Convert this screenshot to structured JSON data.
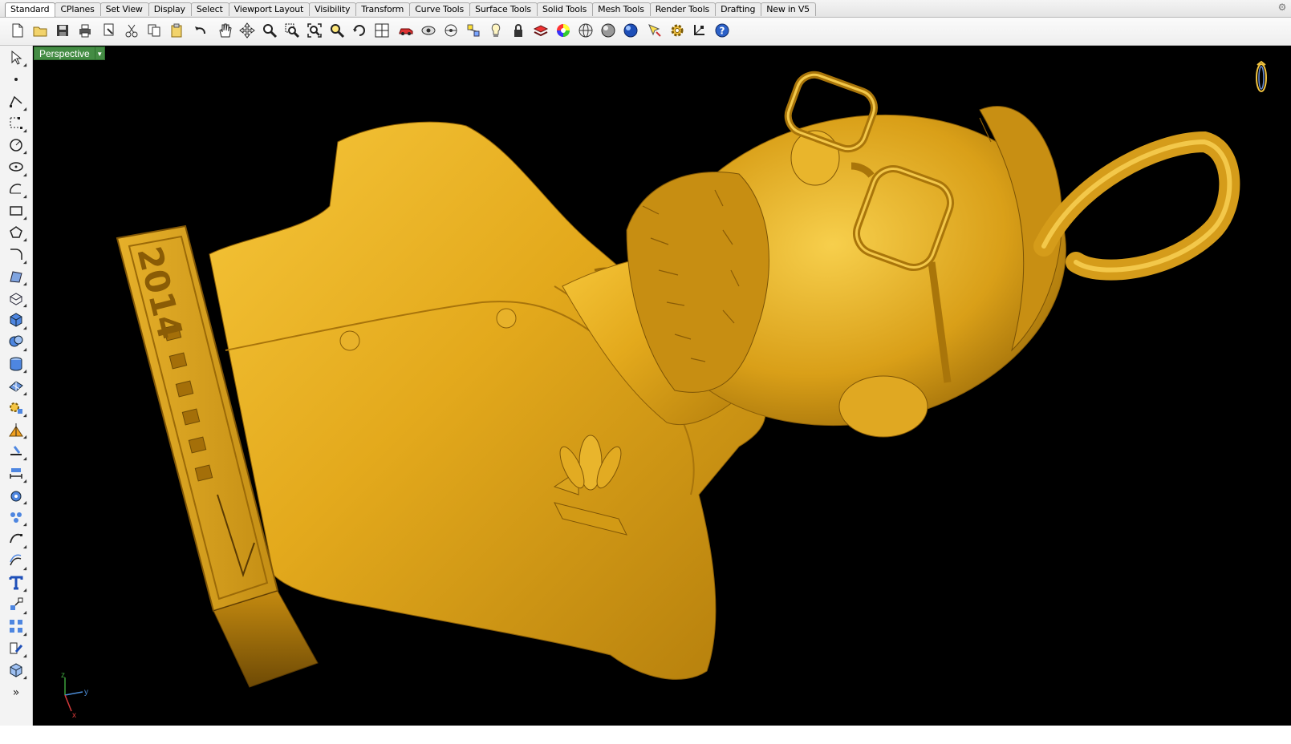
{
  "tabs": [
    {
      "label": "Standard",
      "active": true
    },
    {
      "label": "CPlanes",
      "active": false
    },
    {
      "label": "Set View",
      "active": false
    },
    {
      "label": "Display",
      "active": false
    },
    {
      "label": "Select",
      "active": false
    },
    {
      "label": "Viewport Layout",
      "active": false
    },
    {
      "label": "Visibility",
      "active": false
    },
    {
      "label": "Transform",
      "active": false
    },
    {
      "label": "Curve Tools",
      "active": false
    },
    {
      "label": "Surface Tools",
      "active": false
    },
    {
      "label": "Solid Tools",
      "active": false
    },
    {
      "label": "Mesh Tools",
      "active": false
    },
    {
      "label": "Render Tools",
      "active": false
    },
    {
      "label": "Drafting",
      "active": false
    },
    {
      "label": "New in V5",
      "active": false
    }
  ],
  "toolbar_icons": [
    "new-icon",
    "open-icon",
    "save-icon",
    "print-icon",
    "import-icon",
    "cut-icon",
    "copy-icon",
    "paste-icon",
    "undo-icon",
    "pan-hand-icon",
    "move-view-icon",
    "zoom-icon",
    "zoom-window-icon",
    "zoom-extents-icon",
    "zoom-selected-icon",
    "rotate-view-icon",
    "four-viewports-icon",
    "car-icon",
    "mesh-eye-icon",
    "cplane-icon",
    "points-icon",
    "light-icon",
    "lock-icon",
    "layer-icon",
    "color-wheel-icon",
    "wire-sphere-icon",
    "shaded-sphere-icon",
    "render-sphere-icon",
    "select-filter-icon",
    "options-gear-icon",
    "gumball-icon",
    "help-icon"
  ],
  "left_tools": [
    "select-arrow-icon",
    "point-icon",
    "polyline-icon",
    "curve-icon",
    "circle-icon",
    "ellipse-icon",
    "arc-icon",
    "rectangle-icon",
    "polygon-icon",
    "fillet-curve-icon",
    "surface-corner-icon",
    "extrude-surface-icon",
    "box-solid-icon",
    "boolean-icon",
    "cylinder-tool-icon",
    "mesh-plane-icon",
    "transform-gear-icon",
    "split-icon",
    "trim-icon",
    "dimension-icon",
    "solid-edit-icon",
    "group-icon",
    "curve-from-object-icon",
    "offset-icon",
    "text-icon",
    "explode-icon",
    "array-icon",
    "analyze-icon",
    "render-box-icon",
    "more-icon"
  ],
  "viewport": {
    "title": "Perspective",
    "axes": {
      "x": "x",
      "y": "y",
      "z": "z"
    },
    "model_text": "2014"
  }
}
